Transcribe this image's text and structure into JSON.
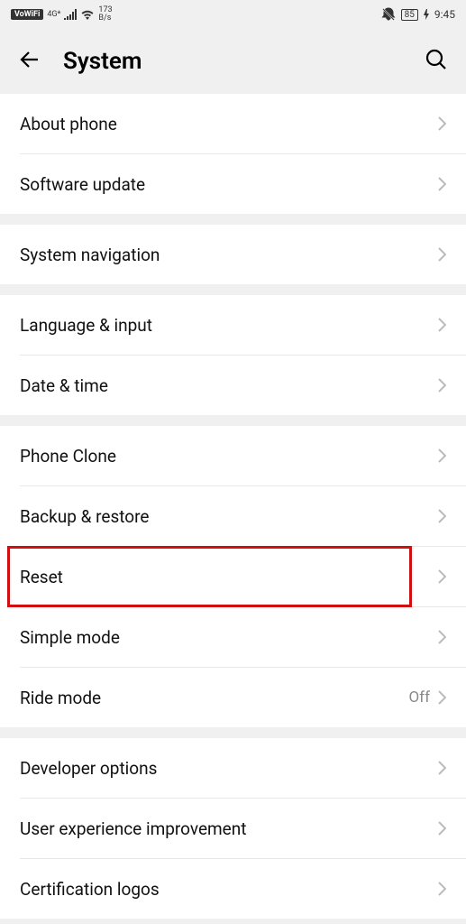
{
  "status": {
    "vowifi": "VoWiFi",
    "network": "4G*",
    "speed_value": "173",
    "speed_unit": "B/s",
    "battery": "85",
    "time": "9:45"
  },
  "header": {
    "title": "System"
  },
  "groups": [
    {
      "rows": [
        {
          "label": "About phone",
          "name": "about-phone"
        },
        {
          "label": "Software update",
          "name": "software-update"
        }
      ]
    },
    {
      "rows": [
        {
          "label": "System navigation",
          "name": "system-navigation"
        }
      ]
    },
    {
      "rows": [
        {
          "label": "Language & input",
          "name": "language-input"
        },
        {
          "label": "Date & time",
          "name": "date-time"
        }
      ]
    },
    {
      "rows": [
        {
          "label": "Phone Clone",
          "name": "phone-clone"
        },
        {
          "label": "Backup & restore",
          "name": "backup-restore"
        },
        {
          "label": "Reset",
          "name": "reset",
          "highlighted": true
        },
        {
          "label": "Simple mode",
          "name": "simple-mode"
        },
        {
          "label": "Ride mode",
          "name": "ride-mode",
          "value": "Off"
        }
      ]
    },
    {
      "rows": [
        {
          "label": "Developer options",
          "name": "developer-options"
        },
        {
          "label": "User experience improvement",
          "name": "user-experience-improvement"
        },
        {
          "label": "Certification logos",
          "name": "certification-logos"
        }
      ]
    }
  ]
}
